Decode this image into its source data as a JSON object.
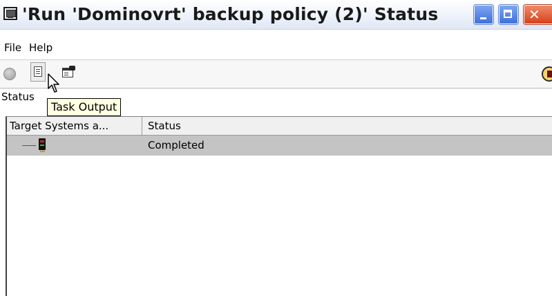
{
  "window": {
    "title": "'Run 'Dominovrt' backup policy (2)' Status",
    "icon": "console-window-icon"
  },
  "menu": {
    "file": "File",
    "help": "Help"
  },
  "toolbar": {
    "buttons": [
      {
        "icon": "stop-icon",
        "enabled": false
      },
      {
        "icon": "task-output-icon",
        "enabled": true
      },
      {
        "icon": "properties-icon",
        "enabled": true
      },
      {
        "icon": "status-indicator-icon",
        "enabled": false
      }
    ]
  },
  "status_label": "Status",
  "tooltip": "Task Output",
  "table": {
    "columns": [
      "Target Systems a...",
      "Status"
    ],
    "rows": [
      {
        "system_icon": "server-icon",
        "status": "Completed",
        "selected": true
      }
    ]
  },
  "colors": {
    "selected_row": "#c4c4c4",
    "tooltip_bg": "#ffffe1",
    "close_button": "#d6421c"
  }
}
